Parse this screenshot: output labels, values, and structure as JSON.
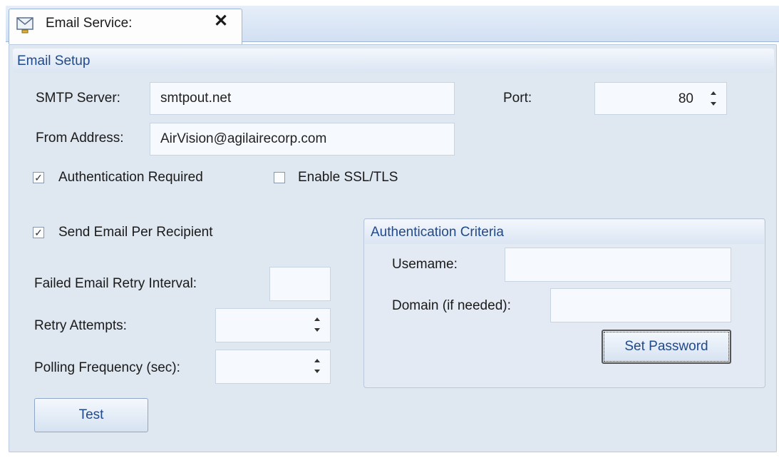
{
  "tab": {
    "title": "Email Service:",
    "close": "✕"
  },
  "panel": {
    "title": "Email Setup"
  },
  "smtp": {
    "label": "SMTP Server:",
    "value": "smtpout.net"
  },
  "port": {
    "label": "Port:",
    "value": "80"
  },
  "from": {
    "label": "From Address:",
    "value": "AirVision@agilairecorp.com"
  },
  "auth_required": {
    "label": "Authentication Required",
    "checked": true,
    "mark": "✓"
  },
  "ssl": {
    "label": "Enable SSL/TLS",
    "checked": false,
    "mark": ""
  },
  "per_recipient": {
    "label": "Send Email Per Recipient",
    "checked": true,
    "mark": "✓"
  },
  "retry_interval": {
    "label": "Failed Email Retry Interval:",
    "value": ""
  },
  "retry_attempts": {
    "label": "Retry Attempts:",
    "value": ""
  },
  "polling": {
    "label": "Polling Frequency (sec):",
    "value": ""
  },
  "test_button": "Test",
  "auth_group": {
    "title": "Authentication Criteria",
    "username_label": "Usemame:",
    "username_value": "",
    "domain_label": "Domain (if needed):",
    "domain_value": "",
    "set_password": "Set Password"
  }
}
